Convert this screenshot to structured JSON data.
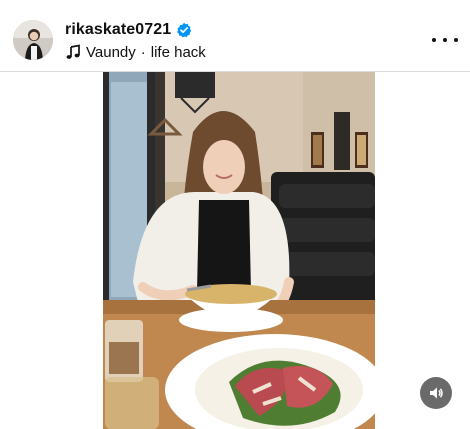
{
  "post": {
    "username": "rikaskate0721",
    "verified": true,
    "audio": {
      "artist": "Vaundy",
      "separator": "·",
      "track": "life hack"
    }
  },
  "icons": {
    "avatar": "profile-photo",
    "verified": "verified-badge-icon",
    "audio": "music-note-icon",
    "more": "more-options-icon",
    "sound": "speaker-volume-icon"
  },
  "colors": {
    "verified_blue": "#0095f6",
    "text": "#111111",
    "divider": "#dbdbdb",
    "sound_button_bg": "#6a6a6a"
  }
}
